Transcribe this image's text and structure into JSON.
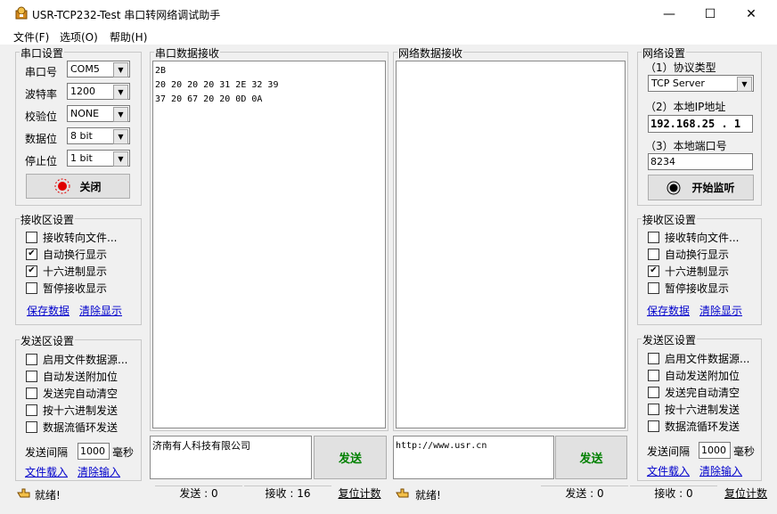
{
  "window": {
    "title": "USR-TCP232-Test 串口转网络调试助手",
    "minimize": "—",
    "maximize": "☐",
    "close": "✕"
  },
  "menu": {
    "file": "文件(F)",
    "options": "选项(O)",
    "help": "帮助(H)"
  },
  "serial_settings": {
    "title": "串口设置",
    "port_label": "串口号",
    "port_value": "COM5",
    "baud_label": "波特率",
    "baud_value": "1200",
    "parity_label": "校验位",
    "parity_value": "NONE",
    "databits_label": "数据位",
    "databits_value": "8 bit",
    "stopbits_label": "停止位",
    "stopbits_value": "1 bit",
    "toggle_button": "关闭"
  },
  "left_receive_settings": {
    "title": "接收区设置",
    "options": [
      {
        "label": "接收转向文件...",
        "checked": false
      },
      {
        "label": "自动换行显示",
        "checked": true
      },
      {
        "label": "十六进制显示",
        "checked": true
      },
      {
        "label": "暂停接收显示",
        "checked": false
      }
    ],
    "save_link": "保存数据",
    "clear_link": "清除显示"
  },
  "left_send_settings": {
    "title": "发送区设置",
    "options": [
      {
        "label": "启用文件数据源...",
        "checked": false
      },
      {
        "label": "自动发送附加位",
        "checked": false
      },
      {
        "label": "发送完自动清空",
        "checked": false
      },
      {
        "label": "按十六进制发送",
        "checked": false
      },
      {
        "label": "数据流循环发送",
        "checked": false
      }
    ],
    "interval_label": "发送间隔",
    "interval_value": "1000",
    "interval_unit": "毫秒",
    "load_link": "文件载入",
    "clear_link": "清除输入"
  },
  "serial_receive": {
    "title": "串口数据接收",
    "content": "2B\n20 20 20 20 31 2E 32 39\n37 20 67 20 20 0D 0A"
  },
  "net_receive": {
    "title": "网络数据接收",
    "content": ""
  },
  "serial_send": {
    "content": "济南有人科技有限公司",
    "send_button": "发送"
  },
  "net_send": {
    "content": "http://www.usr.cn",
    "send_button": "发送"
  },
  "net_settings": {
    "title": "网络设置",
    "protocol_label": "（1）协议类型",
    "protocol_value": "TCP Server",
    "ip_label": "（2）本地IP地址",
    "ip_value": "192.168.25 . 1",
    "port_label": "（3）本地端口号",
    "port_value": "8234",
    "listen_button": "开始监听"
  },
  "right_receive_settings": {
    "title": "接收区设置",
    "options": [
      {
        "label": "接收转向文件...",
        "checked": false
      },
      {
        "label": "自动换行显示",
        "checked": false
      },
      {
        "label": "十六进制显示",
        "checked": true
      },
      {
        "label": "暂停接收显示",
        "checked": false
      }
    ],
    "save_link": "保存数据",
    "clear_link": "清除显示"
  },
  "right_send_settings": {
    "title": "发送区设置",
    "options": [
      {
        "label": "启用文件数据源...",
        "checked": false
      },
      {
        "label": "自动发送附加位",
        "checked": false
      },
      {
        "label": "发送完自动清空",
        "checked": false
      },
      {
        "label": "按十六进制发送",
        "checked": false
      },
      {
        "label": "数据流循环发送",
        "checked": false
      }
    ],
    "interval_label": "发送间隔",
    "interval_value": "1000",
    "interval_unit": "毫秒",
    "load_link": "文件载入",
    "clear_link": "清除输入"
  },
  "status_left": {
    "ready": "就绪!",
    "send": "发送 : 0",
    "recv": "接收 : 16",
    "reset": "复位计数"
  },
  "status_right": {
    "ready": "就绪!",
    "send": "发送 : 0",
    "recv": "接收 : 0",
    "reset": "复位计数"
  },
  "colors": {
    "accent_red": "#e00000",
    "send_text": "#008000",
    "link": "#0000cc"
  }
}
